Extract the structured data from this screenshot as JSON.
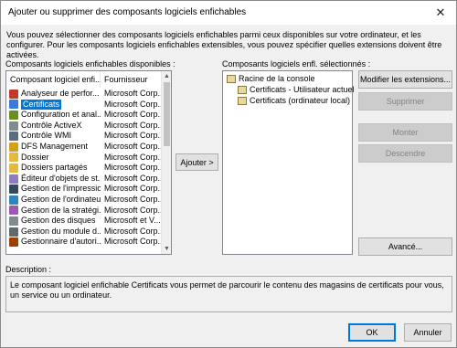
{
  "window": {
    "title": "Ajouter ou supprimer des composants logiciels enfichables",
    "close_glyph": "✕"
  },
  "intro": "Vous pouvez sélectionner des composants logiciels enfichables parmi ceux disponibles sur votre ordinateur, et les configurer. Pour les composants logiciels enfichables extensibles, vous pouvez spécifier quelles extensions doivent être activées.",
  "available": {
    "label": "Composants logiciels enfichables disponibles :",
    "columns": [
      "Composant logiciel enfi...",
      "Fournisseur"
    ],
    "rows": [
      {
        "name": "Analyseur de perfor...",
        "vendor": "Microsoft Corp...",
        "icon": "performance-icon",
        "color": "#c0392b"
      },
      {
        "name": "Certificats",
        "vendor": "Microsoft Corp...",
        "icon": "certificate-icon",
        "color": "#3a7bd5"
      },
      {
        "name": "Configuration et anal...",
        "vendor": "Microsoft Corp...",
        "icon": "config-icon",
        "color": "#6b8e23"
      },
      {
        "name": "Contrôle ActiveX",
        "vendor": "Microsoft Corp...",
        "icon": "activex-icon",
        "color": "#7f8c8d"
      },
      {
        "name": "Contrôle WMI",
        "vendor": "Microsoft Corp...",
        "icon": "wmi-icon",
        "color": "#5d6d7e"
      },
      {
        "name": "DFS Management",
        "vendor": "Microsoft Corp...",
        "icon": "dfs-icon",
        "color": "#d4a017"
      },
      {
        "name": "Dossier",
        "vendor": "Microsoft Corp...",
        "icon": "folder-icon",
        "color": "#e5b93e"
      },
      {
        "name": "Dossiers partagés",
        "vendor": "Microsoft Corp...",
        "icon": "shared-folder-icon",
        "color": "#e5b93e"
      },
      {
        "name": "Éditeur d'objets de st...",
        "vendor": "Microsoft Corp...",
        "icon": "gpo-editor-icon",
        "color": "#8e7cc3"
      },
      {
        "name": "Gestion de l'impression",
        "vendor": "Microsoft Corp...",
        "icon": "printer-icon",
        "color": "#34495e"
      },
      {
        "name": "Gestion de l'ordinateur",
        "vendor": "Microsoft Corp...",
        "icon": "computer-icon",
        "color": "#2e86c1"
      },
      {
        "name": "Gestion de la stratégi...",
        "vendor": "Microsoft Corp...",
        "icon": "policy-icon",
        "color": "#9b59b6"
      },
      {
        "name": "Gestion des disques",
        "vendor": "Microsoft et V...",
        "icon": "disk-icon",
        "color": "#7f8c8d"
      },
      {
        "name": "Gestion du module d...",
        "vendor": "Microsoft Corp...",
        "icon": "tpm-icon",
        "color": "#616a6b"
      },
      {
        "name": "Gestionnaire d'autori...",
        "vendor": "Microsoft Corp...",
        "icon": "auth-manager-icon",
        "color": "#a04000"
      }
    ],
    "selected_index": 1
  },
  "add_button": "Ajouter >",
  "selected": {
    "label": "Composants logiciels enfl. sélectionnés :",
    "root": "Racine de la console",
    "children": [
      "Certificats - Utilisateur actuel",
      "Certificats (ordinateur local)"
    ]
  },
  "side_buttons": {
    "edit_extensions": "Modifier les extensions...",
    "remove": "Supprimer",
    "move_up": "Monter",
    "move_down": "Descendre",
    "advanced": "Avancé..."
  },
  "description": {
    "label": "Description :",
    "text": "Le composant logiciel enfichable Certificats vous permet de parcourir le contenu des magasins de certificats pour vous, un service ou un ordinateur."
  },
  "footer": {
    "ok": "OK",
    "cancel": "Annuler"
  }
}
